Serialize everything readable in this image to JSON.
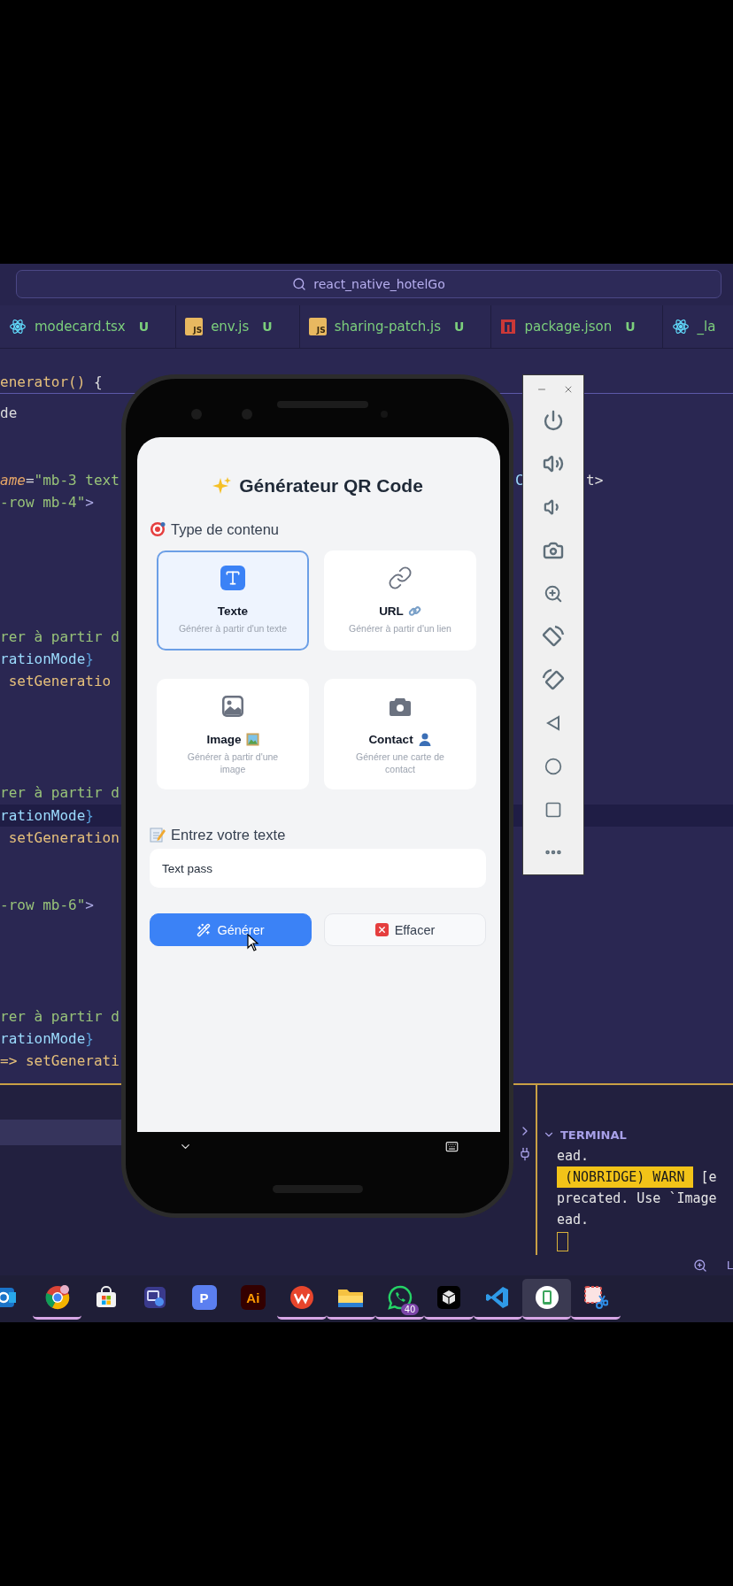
{
  "search": {
    "value": "react_native_hotelGo"
  },
  "tabs": [
    {
      "kind": "react",
      "label": "modecard.tsx",
      "status": "U"
    },
    {
      "kind": "js",
      "badge": "JS",
      "label": "env.js",
      "status": "U"
    },
    {
      "kind": "js",
      "badge": "JS",
      "label": "sharing-patch.js",
      "status": "U"
    },
    {
      "kind": "npm",
      "label": "package.json",
      "status": "U"
    },
    {
      "kind": "react",
      "label": "_la"
    }
  ],
  "editor": {
    "sticky_line": [
      {
        "kind": "fn",
        "text": "enerator()"
      },
      {
        "kind": "plain",
        "text": " {"
      }
    ],
    "lines": [
      {
        "kind": "code",
        "current": false,
        "tokens": [
          {
            "kind": "plain",
            "text": "de"
          }
        ]
      },
      {
        "kind": "blank",
        "current": false
      },
      {
        "kind": "blank",
        "current": false
      },
      {
        "kind": "code",
        "current": false,
        "tokens": [
          {
            "kind": "attr",
            "text": "ame"
          },
          {
            "kind": "plain",
            "text": "="
          },
          {
            "kind": "str",
            "text": "\"mb-3 text"
          }
        ],
        "right": [
          {
            "kind": "var",
            "text": "C"
          },
          {
            "kind": "plain",
            "text": "t>"
          }
        ]
      },
      {
        "kind": "code",
        "current": false,
        "tokens": [
          {
            "kind": "str",
            "text": "-row mb-4\""
          },
          {
            "kind": "tag",
            "text": ">"
          }
        ]
      },
      {
        "kind": "blank",
        "current": false
      },
      {
        "kind": "blank",
        "current": false
      },
      {
        "kind": "blank",
        "current": false
      },
      {
        "kind": "blank",
        "current": false
      },
      {
        "kind": "blank",
        "current": false
      },
      {
        "kind": "code",
        "current": false,
        "tokens": [
          {
            "kind": "str",
            "text": "rer à partir d"
          }
        ]
      },
      {
        "kind": "code",
        "current": false,
        "tokens": [
          {
            "kind": "var",
            "text": "rationMode"
          },
          {
            "kind": "brace",
            "text": "}"
          }
        ]
      },
      {
        "kind": "code",
        "current": false,
        "tokens": [
          {
            "kind": "fn",
            "text": " setGeneratio"
          }
        ]
      },
      {
        "kind": "blank",
        "current": false
      },
      {
        "kind": "blank",
        "current": false
      },
      {
        "kind": "blank",
        "current": false
      },
      {
        "kind": "blank",
        "current": false
      },
      {
        "kind": "code",
        "current": false,
        "tokens": [
          {
            "kind": "str",
            "text": "rer à partir d"
          }
        ]
      },
      {
        "kind": "code",
        "current": true,
        "tokens": [
          {
            "kind": "var",
            "text": "rationMode"
          },
          {
            "kind": "brace",
            "text": "}"
          }
        ]
      },
      {
        "kind": "code",
        "current": false,
        "tokens": [
          {
            "kind": "fn",
            "text": " setGeneration"
          }
        ]
      },
      {
        "kind": "blank",
        "current": false
      },
      {
        "kind": "blank",
        "current": false
      },
      {
        "kind": "code",
        "current": false,
        "tokens": [
          {
            "kind": "str",
            "text": "-row mb-6\""
          },
          {
            "kind": "tag",
            "text": ">"
          }
        ]
      },
      {
        "kind": "blank",
        "current": false
      },
      {
        "kind": "blank",
        "current": false
      },
      {
        "kind": "blank",
        "current": false
      },
      {
        "kind": "blank",
        "current": false
      },
      {
        "kind": "code",
        "current": false,
        "tokens": [
          {
            "kind": "str",
            "text": "rer à partir d"
          }
        ]
      },
      {
        "kind": "code",
        "current": false,
        "tokens": [
          {
            "kind": "var",
            "text": "rationMode"
          },
          {
            "kind": "brace",
            "text": "}"
          }
        ]
      },
      {
        "kind": "code",
        "current": false,
        "tokens": [
          {
            "kind": "fn",
            "text": "=> setGenerati"
          }
        ]
      }
    ]
  },
  "terminal": {
    "title": "TERMINAL",
    "lines": [
      {
        "kind": "text",
        "text": "ead."
      },
      {
        "kind": "warn",
        "badge": " (NOBRIDGE) WARN ",
        "text": "[e"
      },
      {
        "kind": "text",
        "text": "precated. Use `Image"
      },
      {
        "kind": "text",
        "text": "ead."
      }
    ],
    "status": "L"
  },
  "phone": {
    "title": "Générateur QR Code",
    "section": "Type de contenu",
    "options": [
      {
        "kind": "text",
        "title": "Texte",
        "description": "Générer à partir d'un texte",
        "selected": true
      },
      {
        "kind": "url",
        "title": "URL",
        "description": "Générer à partir d'un lien",
        "selected": false
      },
      {
        "kind": "image",
        "title": "Image",
        "description": "Générer à partir d'une image",
        "selected": false
      },
      {
        "kind": "contact",
        "title": "Contact",
        "description": "Générer une carte de contact",
        "selected": false
      }
    ],
    "input_label": "Entrez votre texte",
    "input": {
      "value": "Text pass"
    },
    "buttons": [
      {
        "kind": "primary",
        "label": "Générer"
      },
      {
        "kind": "secondary",
        "label": "Effacer"
      }
    ]
  },
  "taskbar": [
    {
      "kind": "mail",
      "running": false,
      "selected": false
    },
    {
      "kind": "browser",
      "running": true,
      "selected": false
    },
    {
      "kind": "store",
      "running": false,
      "selected": false
    },
    {
      "kind": "remote",
      "running": false,
      "selected": false
    },
    {
      "kind": "letter",
      "label": "P",
      "running": false,
      "selected": false
    },
    {
      "kind": "illustrator",
      "label": "Ai",
      "running": false,
      "selected": false
    },
    {
      "kind": "office",
      "running": true,
      "selected": false
    },
    {
      "kind": "folder",
      "running": true,
      "selected": false
    },
    {
      "kind": "chat",
      "badge": "40",
      "running": true,
      "selected": false
    },
    {
      "kind": "cube",
      "running": true,
      "selected": false
    },
    {
      "kind": "editor",
      "running": true,
      "selected": false
    },
    {
      "kind": "emulator",
      "running": true,
      "selected": true
    },
    {
      "kind": "snip",
      "running": true,
      "selected": false
    }
  ]
}
